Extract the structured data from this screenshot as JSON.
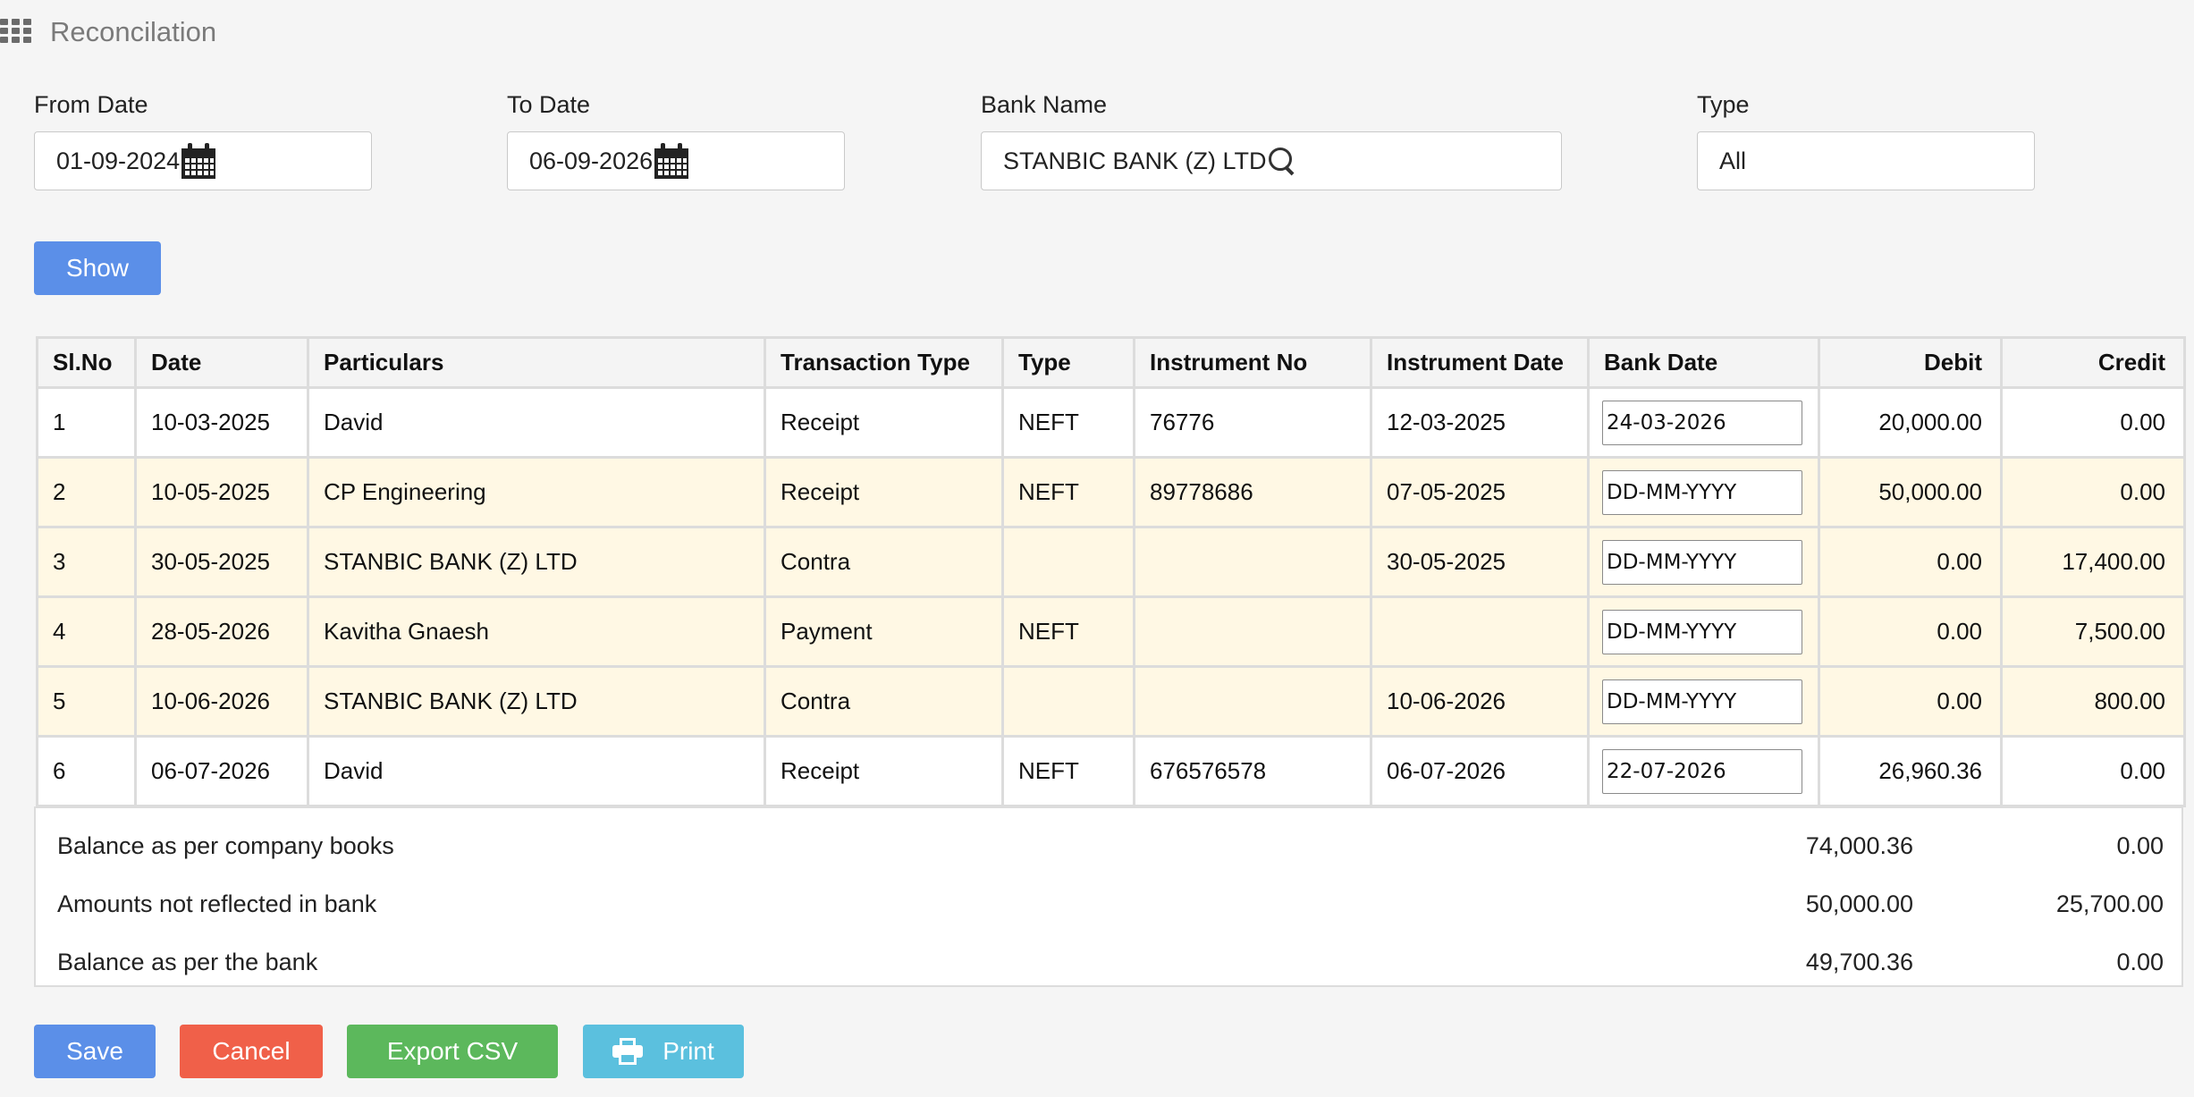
{
  "header": {
    "title": "Reconcilation"
  },
  "filters": {
    "from_date": {
      "label": "From Date",
      "value": "01-09-2024"
    },
    "to_date": {
      "label": "To Date",
      "value": "06-09-2026"
    },
    "bank_name": {
      "label": "Bank Name",
      "value": "STANBIC BANK (Z) LTD"
    },
    "type": {
      "label": "Type",
      "value": "All"
    }
  },
  "show_label": "Show",
  "table": {
    "columns": [
      "Sl.No",
      "Date",
      "Particulars",
      "Transaction Type",
      "Type",
      "Instrument No",
      "Instrument Date",
      "Bank Date",
      "Debit",
      "Credit"
    ],
    "bank_date_placeholder": "DD-MM-YYYY",
    "rows": [
      {
        "sl": "1",
        "date": "10-03-2025",
        "particulars": "David",
        "transaction_type": "Receipt",
        "type": "NEFT",
        "instrument_no": "76776",
        "instrument_date": "12-03-2025",
        "bank_date": "24-03-2026",
        "debit": "20,000.00",
        "credit": "0.00",
        "highlight": false
      },
      {
        "sl": "2",
        "date": "10-05-2025",
        "particulars": "CP Engineering",
        "transaction_type": "Receipt",
        "type": "NEFT",
        "instrument_no": "89778686",
        "instrument_date": "07-05-2025",
        "bank_date": "",
        "debit": "50,000.00",
        "credit": "0.00",
        "highlight": true
      },
      {
        "sl": "3",
        "date": "30-05-2025",
        "particulars": "STANBIC BANK (Z) LTD",
        "transaction_type": "Contra",
        "type": "",
        "instrument_no": "",
        "instrument_date": "30-05-2025",
        "bank_date": "",
        "debit": "0.00",
        "credit": "17,400.00",
        "highlight": true
      },
      {
        "sl": "4",
        "date": "28-05-2026",
        "particulars": "Kavitha Gnaesh",
        "transaction_type": "Payment",
        "type": "NEFT",
        "instrument_no": "",
        "instrument_date": "",
        "bank_date": "",
        "debit": "0.00",
        "credit": "7,500.00",
        "highlight": true
      },
      {
        "sl": "5",
        "date": "10-06-2026",
        "particulars": "STANBIC BANK (Z) LTD",
        "transaction_type": "Contra",
        "type": "",
        "instrument_no": "",
        "instrument_date": "10-06-2026",
        "bank_date": "",
        "debit": "0.00",
        "credit": "800.00",
        "highlight": true
      },
      {
        "sl": "6",
        "date": "06-07-2026",
        "particulars": "David",
        "transaction_type": "Receipt",
        "type": "NEFT",
        "instrument_no": "676576578",
        "instrument_date": "06-07-2026",
        "bank_date": "22-07-2026",
        "debit": "26,960.36",
        "credit": "0.00",
        "highlight": false
      }
    ]
  },
  "summary": [
    {
      "label": "Balance as per company books",
      "debit": "74,000.36",
      "credit": "0.00"
    },
    {
      "label": "Amounts not reflected in bank",
      "debit": "50,000.00",
      "credit": "25,700.00"
    },
    {
      "label": "Balance as per the bank",
      "debit": "49,700.36",
      "credit": "0.00"
    }
  ],
  "actions": {
    "save": "Save",
    "cancel": "Cancel",
    "export": "Export CSV",
    "print": "Print"
  },
  "colors": {
    "primary": "#5b8fe8",
    "danger": "#f06049",
    "success": "#5cb85c",
    "info": "#5bc0de",
    "row_highlight": "#fff8e4"
  },
  "icons": {
    "menu": "grid-icon",
    "from_date": "calendar-icon",
    "to_date": "calendar-icon",
    "bank_search": "search-icon",
    "print": "printer-icon"
  }
}
